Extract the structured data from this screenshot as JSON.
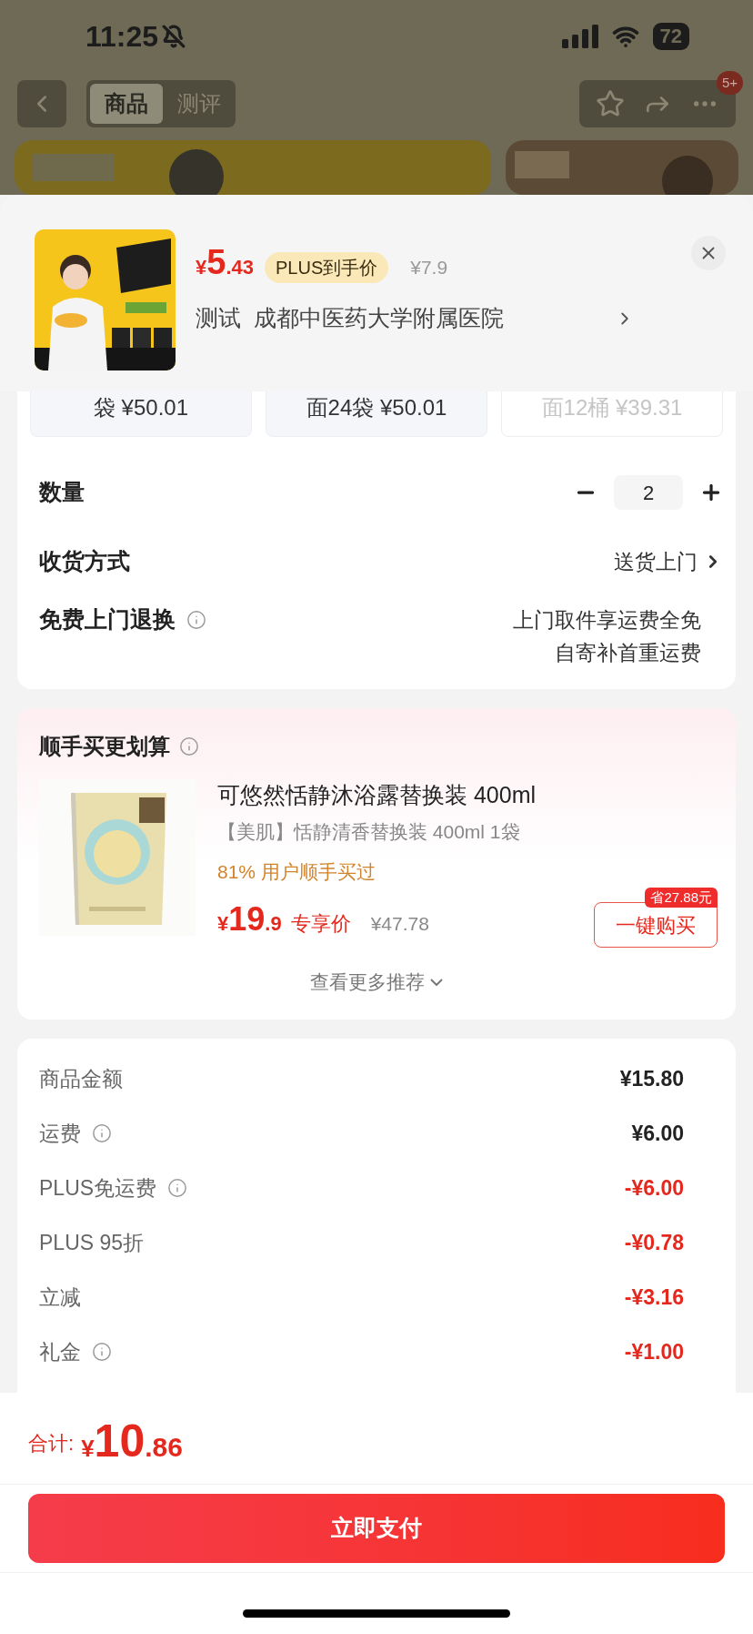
{
  "status_bar": {
    "time": "11:25",
    "battery": "72"
  },
  "nav": {
    "tabs": [
      {
        "label": "商品",
        "selected": true
      },
      {
        "label": "测评",
        "selected": false
      }
    ],
    "badge": "5+"
  },
  "product": {
    "price_symbol": "¥",
    "price_integer": "5",
    "price_decimal": ".43",
    "price_tag": "PLUS到手价",
    "original_price": "¥7.9",
    "title_prefix": "测试",
    "title": "成都中医药大学附属医院"
  },
  "variants": [
    {
      "text": "袋 ¥50.01",
      "disabled": false
    },
    {
      "text": "面24袋 ¥50.01",
      "disabled": false
    },
    {
      "text": "面12桶 ¥39.31",
      "disabled": true
    }
  ],
  "quantity": {
    "label": "数量",
    "value": "2"
  },
  "delivery": {
    "label": "收货方式",
    "value": "送货上门"
  },
  "returns": {
    "label": "免费上门退换",
    "lines": [
      "上门取件享运费全免",
      "自寄补首重运费"
    ]
  },
  "recommend": {
    "title": "顺手买更划算",
    "name": "可悠然恬静沐浴露替换装 400ml",
    "spec": "【美肌】恬静清香替换装 400ml 1袋",
    "social": "81% 用户顺手买过",
    "price_symbol": "¥",
    "price_integer": "19",
    "price_decimal": ".9",
    "price_tag": "专享价",
    "original_price": "¥47.78",
    "saving": "省27.88元",
    "buy_button": "一键购买",
    "more": "查看更多推荐"
  },
  "fees": [
    {
      "label": "商品金额",
      "info": false,
      "amount": "¥15.80",
      "kind": "charge"
    },
    {
      "label": "运费",
      "info": true,
      "amount": "¥6.00",
      "kind": "charge"
    },
    {
      "label": "PLUS免运费",
      "info": true,
      "amount": "-¥6.00",
      "kind": "discount"
    },
    {
      "label": "PLUS 95折",
      "info": false,
      "amount": "-¥0.78",
      "kind": "discount"
    },
    {
      "label": "立减",
      "info": false,
      "amount": "-¥3.16",
      "kind": "discount"
    },
    {
      "label": "礼金",
      "info": true,
      "amount": "-¥1.00",
      "kind": "discount"
    }
  ],
  "total": {
    "label": "合计:",
    "symbol": "¥",
    "integer": "10",
    "decimal": ".86"
  },
  "pay_button": "立即支付"
}
